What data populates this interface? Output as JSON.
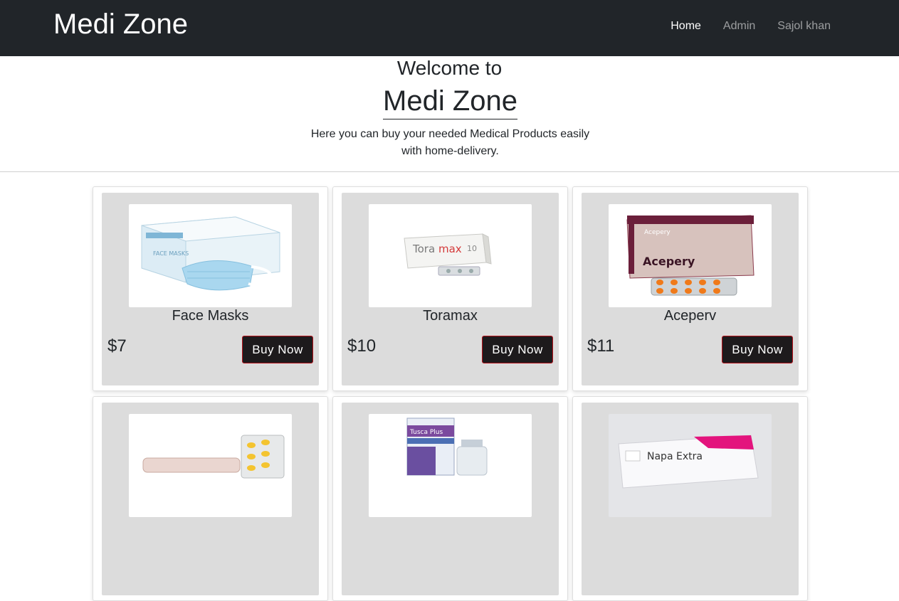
{
  "navbar": {
    "brand": "Medi Zone",
    "links": [
      "Home",
      "Admin",
      "Sajol khan"
    ]
  },
  "hero": {
    "welcome": "Welcome to",
    "title": "Medi Zone",
    "subtitle": "Here you can buy your needed Medical Products easily with home-delivery."
  },
  "products": [
    {
      "name": "Face Masks",
      "price": "$7",
      "button": "Buy Now",
      "image": "face-masks-box-image",
      "box_text": "FACE MASKS"
    },
    {
      "name": "Toramax",
      "price": "$10",
      "button": "Buy Now",
      "image": "toramax-box-image",
      "box_text": "Toramax"
    },
    {
      "name": "Aceperv",
      "price": "$11",
      "button": "Buy Now",
      "image": "acepery-box-image",
      "box_text": "Acepery"
    },
    {
      "name": "",
      "price": "",
      "button": "",
      "image": "tablet-strip-image",
      "box_text": ""
    },
    {
      "name": "",
      "price": "",
      "button": "",
      "image": "tusca-plus-box-image",
      "box_text": "Tusca Plus"
    },
    {
      "name": "",
      "price": "",
      "button": "",
      "image": "napa-extra-box-image",
      "box_text": "Napa Extra"
    }
  ]
}
